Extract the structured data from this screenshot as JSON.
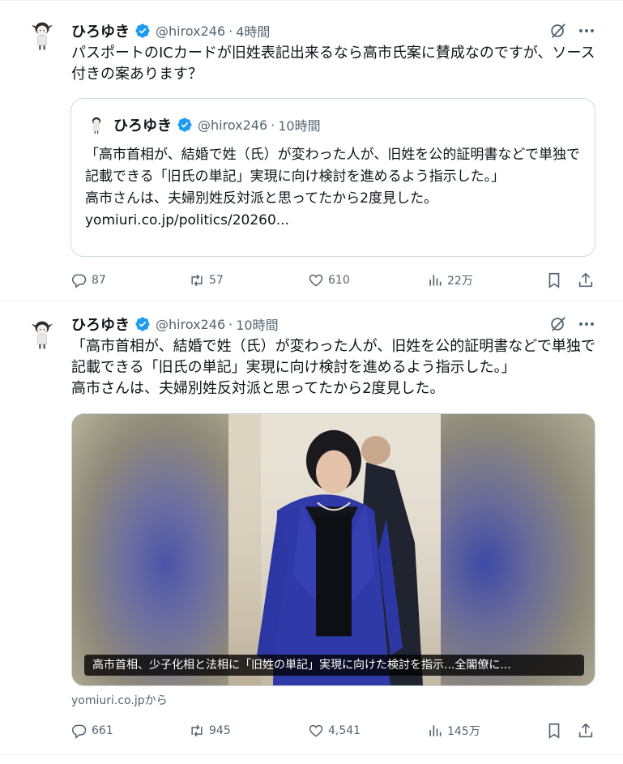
{
  "tweets": [
    {
      "name": "ひろゆき",
      "handle": "@hirox246",
      "time": "4時間",
      "text": "パスポートのICカードが旧姓表記出来るなら高市氏案に賛成なのですが、ソース付きの案あります？",
      "quote": {
        "name": "ひろゆき",
        "handle": "@hirox246",
        "time": "10時間",
        "text": "「高市首相が、結婚で姓（氏）が変わった人が、旧姓を公的証明書などで単独で記載できる「旧氏の単記」実現に向け検討を進めるよう指示した。」\n高市さんは、夫婦別姓反対派と思ってたから2度見した。\nyomiuri.co.jp/politics/20260..."
      },
      "actions": {
        "reply": "87",
        "retweet": "57",
        "like": "610",
        "views": "22万"
      }
    },
    {
      "name": "ひろゆき",
      "handle": "@hirox246",
      "time": "10時間",
      "text": "「高市首相が、結婚で姓（氏）が変わった人が、旧姓を公的証明書などで単独で記載できる「旧氏の単記」実現に向け検討を進めるよう指示した。」\n高市さんは、夫婦別姓反対派と思ってたから2度見した。",
      "card": {
        "caption": "高市首相、少子化相と法相に「旧姓の単記」実現に向けた検討を指示...全閣僚に...",
        "source": "yomiuri.co.jpから"
      },
      "actions": {
        "reply": "661",
        "retweet": "945",
        "like": "4,541",
        "views": "145万"
      }
    }
  ],
  "colors": {
    "verified": "#1d9bf0",
    "muted": "#536471",
    "border": "#cfd9de"
  },
  "icons": [
    "verified-badge-icon",
    "grok-icon",
    "more-icon",
    "reply-icon",
    "retweet-icon",
    "like-icon",
    "views-icon",
    "bookmark-icon",
    "share-icon"
  ]
}
